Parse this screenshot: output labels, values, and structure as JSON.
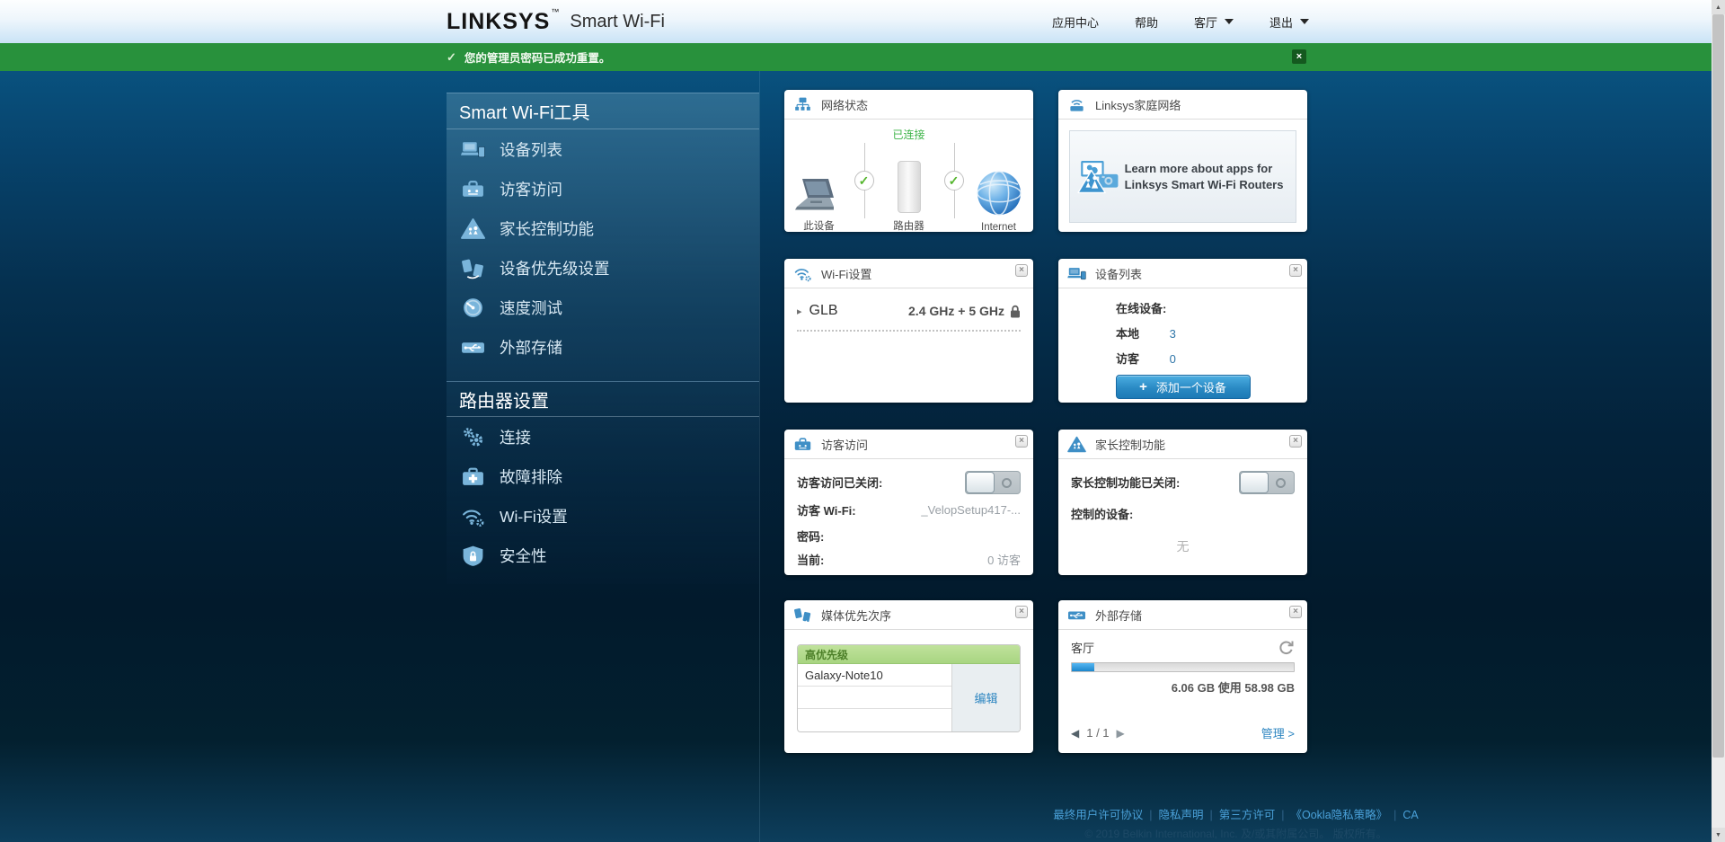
{
  "colors": {
    "banner_green": "#28913c",
    "link_blue": "#2e86c1",
    "count_blue": "#2e75a8",
    "header_icon_blue": "#3f8fc6"
  },
  "icons": {
    "check": "✓",
    "close": "×",
    "play": "▸",
    "prev": "◀",
    "next": "▶",
    "plus": "+",
    "scroll_up": "▲",
    "scroll_down": "▼"
  },
  "header": {
    "logo_primary": "LINKSYS",
    "logo_tm": "™",
    "logo_secondary": "Smart Wi-Fi",
    "nav": [
      {
        "label": "应用中心",
        "dropdown": false
      },
      {
        "label": "帮助",
        "dropdown": false
      },
      {
        "label": "客厅",
        "dropdown": true
      },
      {
        "label": "退出",
        "dropdown": true
      }
    ]
  },
  "banner": {
    "message": "您的管理员密码已成功重置。"
  },
  "sidebar": {
    "sections": [
      {
        "title": "Smart Wi-Fi工具",
        "items": [
          {
            "label": "设备列表",
            "icon": "devices-icon"
          },
          {
            "label": "访客访问",
            "icon": "guest-suitcase-icon"
          },
          {
            "label": "家长控制功能",
            "icon": "parental-triangle-icon"
          },
          {
            "label": "设备优先级设置",
            "icon": "prioritization-icon"
          },
          {
            "label": "速度测试",
            "icon": "speedometer-icon"
          },
          {
            "label": "外部存储",
            "icon": "usb-storage-icon"
          }
        ]
      },
      {
        "title": "路由器设置",
        "items": [
          {
            "label": "连接",
            "icon": "gears-icon"
          },
          {
            "label": "故障排除",
            "icon": "first-aid-icon"
          },
          {
            "label": "Wi-Fi设置",
            "icon": "wifi-gear-icon"
          },
          {
            "label": "安全性",
            "icon": "shield-lock-icon"
          }
        ]
      }
    ]
  },
  "cards": {
    "network_status": {
      "title": "网络状态",
      "connected_label": "已连接",
      "nodes": {
        "device": "此设备",
        "router": "路由器",
        "internet": "Internet"
      }
    },
    "home_network": {
      "title": "Linksys家庭网络",
      "promo_text": "Learn more about apps for Linksys Smart Wi-Fi Routers"
    },
    "wifi_settings": {
      "title": "Wi-Fi设置",
      "ssid": "GLB",
      "bands": "2.4 GHz + 5 GHz"
    },
    "device_list": {
      "title": "设备列表",
      "online_label": "在线设备:",
      "local_label": "本地",
      "local_count": "3",
      "guest_label": "访客",
      "guest_count": "0",
      "add_button": "添加一个设备"
    },
    "guest_access": {
      "title": "访客访问",
      "status_label": "访客访问已关闭:",
      "wifi_label": "访客 Wi-Fi:",
      "wifi_value": "_VelopSetup417-...",
      "password_label": "密码:",
      "current_label": "当前:",
      "current_value": "0 访客"
    },
    "parental_controls": {
      "title": "家长控制功能",
      "status_label": "家长控制功能已关闭:",
      "devices_label": "控制的设备:",
      "devices_value": "无"
    },
    "media_priority": {
      "title": "媒体优先次序",
      "table_header": "高优先级",
      "rows": [
        "Galaxy-Note10",
        "",
        ""
      ],
      "edit_label": "编辑"
    },
    "external_storage": {
      "title": "外部存储",
      "device_name": "客厅",
      "usage_text": "6.06 GB 使用 58.98 GB",
      "usage_percent": 10.3,
      "fill_style": "width:10.3%",
      "pagination": "1 / 1",
      "manage_label": "管理 >"
    }
  },
  "footer": {
    "links": [
      "最终用户许可协议",
      "隐私声明",
      "第三方许可",
      "《Ookla隐私策略》",
      "CA"
    ],
    "separator": "|",
    "copyright": "© 2019 Belkin International, Inc. 及/或其附属公司。 版权所有。"
  }
}
